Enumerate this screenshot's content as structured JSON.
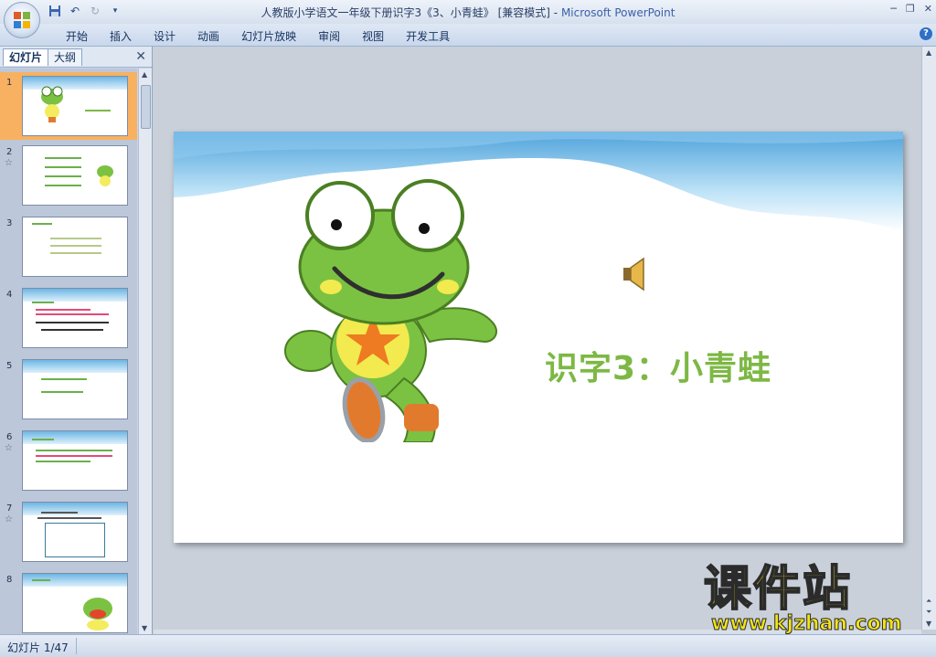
{
  "window": {
    "title": "人教版小学语文一年级下册识字3《3、小青蛙》 [兼容模式] - ",
    "app_name": "Microsoft PowerPoint"
  },
  "ribbon": {
    "tabs": [
      {
        "label": "开始"
      },
      {
        "label": "插入"
      },
      {
        "label": "设计"
      },
      {
        "label": "动画"
      },
      {
        "label": "幻灯片放映"
      },
      {
        "label": "审阅"
      },
      {
        "label": "视图"
      },
      {
        "label": "开发工具"
      }
    ],
    "help_label": "?"
  },
  "panel": {
    "tab_slides": "幻灯片",
    "tab_outline": "大纲",
    "close_glyph": "✕",
    "thumbnails": [
      {
        "number": "1",
        "star": false,
        "active": true
      },
      {
        "number": "2",
        "star": true,
        "active": false
      },
      {
        "number": "3",
        "star": false,
        "active": false
      },
      {
        "number": "4",
        "star": false,
        "active": false
      },
      {
        "number": "5",
        "star": false,
        "active": false
      },
      {
        "number": "6",
        "star": true,
        "active": false
      },
      {
        "number": "7",
        "star": true,
        "active": false
      },
      {
        "number": "8",
        "star": false,
        "active": false
      }
    ]
  },
  "slide": {
    "title": "识字3：小青蛙",
    "icons": [
      "frog-illustration",
      "speaker-icon"
    ]
  },
  "status": {
    "text": "幻灯片 1/47"
  },
  "watermark": {
    "cn": "课件站",
    "url": "www.kjzhan.com"
  },
  "colors": {
    "accent_title": "#7db845",
    "thumb_active": "#f7b160",
    "watermark": "#f2e416"
  }
}
